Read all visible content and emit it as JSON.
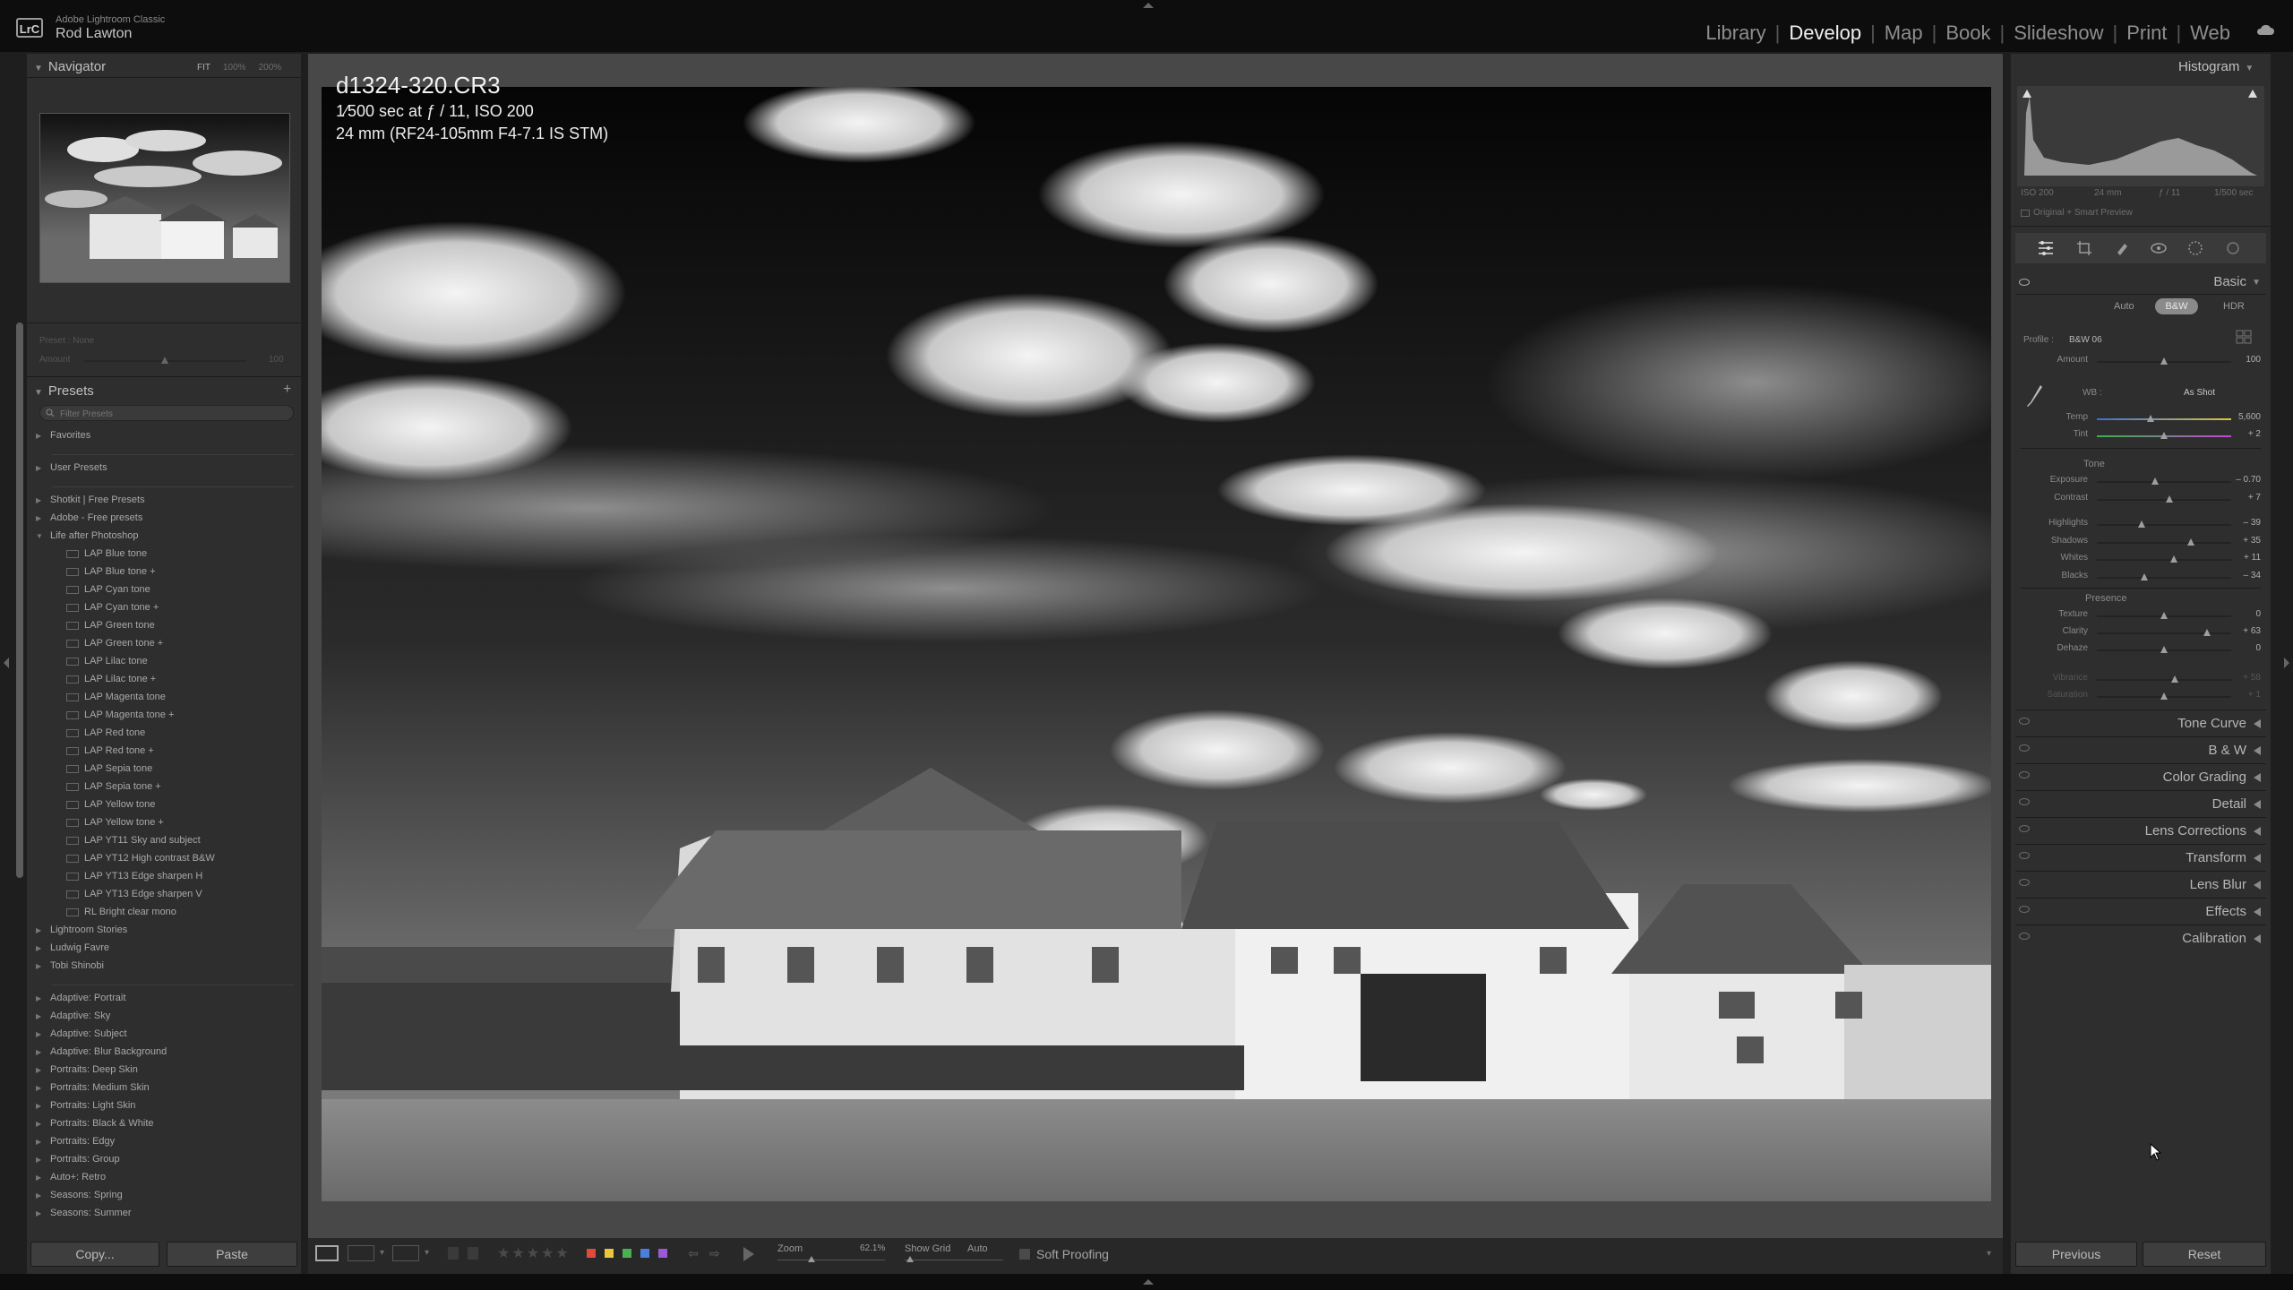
{
  "app": {
    "name": "Adobe Lightroom Classic",
    "logo": "LrC",
    "user": "Rod Lawton"
  },
  "modules": [
    {
      "label": "Library",
      "active": false
    },
    {
      "label": "Develop",
      "active": true
    },
    {
      "label": "Map",
      "active": false
    },
    {
      "label": "Book",
      "active": false
    },
    {
      "label": "Slideshow",
      "active": false
    },
    {
      "label": "Print",
      "active": false
    },
    {
      "label": "Web",
      "active": false
    }
  ],
  "navigator": {
    "title": "Navigator",
    "zoom_options": [
      "FIT",
      "100%",
      "200%"
    ],
    "preset_label": "Preset : None",
    "amount_label": "Amount",
    "amount_value": "100"
  },
  "presets": {
    "title": "Presets",
    "search_placeholder": "Filter Presets",
    "items": [
      {
        "label": "Favorites",
        "type": "group"
      },
      {
        "label": "User Presets",
        "type": "group"
      },
      {
        "label": "Shotkit | Free Presets",
        "type": "group"
      },
      {
        "label": "Adobe - Free presets",
        "type": "group"
      },
      {
        "label": "Life after Photoshop",
        "type": "open-group"
      },
      {
        "label": "LAP Blue tone",
        "type": "child"
      },
      {
        "label": "LAP Blue tone +",
        "type": "child"
      },
      {
        "label": "LAP Cyan tone",
        "type": "child"
      },
      {
        "label": "LAP Cyan tone +",
        "type": "child"
      },
      {
        "label": "LAP Green tone",
        "type": "child"
      },
      {
        "label": "LAP Green tone +",
        "type": "child"
      },
      {
        "label": "LAP Lilac tone",
        "type": "child"
      },
      {
        "label": "LAP Lilac tone +",
        "type": "child"
      },
      {
        "label": "LAP Magenta tone",
        "type": "child"
      },
      {
        "label": "LAP Magenta tone +",
        "type": "child"
      },
      {
        "label": "LAP Red tone",
        "type": "child"
      },
      {
        "label": "LAP Red tone +",
        "type": "child"
      },
      {
        "label": "LAP Sepia tone",
        "type": "child"
      },
      {
        "label": "LAP Sepia tone +",
        "type": "child"
      },
      {
        "label": "LAP Yellow tone",
        "type": "child"
      },
      {
        "label": "LAP Yellow tone +",
        "type": "child"
      },
      {
        "label": "LAP YT11 Sky and subject",
        "type": "child"
      },
      {
        "label": "LAP YT12 High contrast B&W",
        "type": "child"
      },
      {
        "label": "LAP YT13 Edge sharpen H",
        "type": "child"
      },
      {
        "label": "LAP YT13 Edge sharpen V",
        "type": "child"
      },
      {
        "label": "RL Bright clear mono",
        "type": "child"
      },
      {
        "label": "Lightroom Stories",
        "type": "group"
      },
      {
        "label": "Ludwig Favre",
        "type": "group"
      },
      {
        "label": "Tobi Shinobi",
        "type": "group"
      },
      {
        "label": "Adaptive: Portrait",
        "type": "group"
      },
      {
        "label": "Adaptive: Sky",
        "type": "group"
      },
      {
        "label": "Adaptive: Subject",
        "type": "group"
      },
      {
        "label": "Adaptive: Blur Background",
        "type": "group"
      },
      {
        "label": "Portraits: Deep Skin",
        "type": "group"
      },
      {
        "label": "Portraits: Medium Skin",
        "type": "group"
      },
      {
        "label": "Portraits: Light Skin",
        "type": "group"
      },
      {
        "label": "Portraits: Black & White",
        "type": "group"
      },
      {
        "label": "Portraits: Edgy",
        "type": "group"
      },
      {
        "label": "Portraits: Group",
        "type": "group"
      },
      {
        "label": "Auto+: Retro",
        "type": "group"
      },
      {
        "label": "Seasons: Spring",
        "type": "group"
      },
      {
        "label": "Seasons: Summer",
        "type": "group"
      }
    ]
  },
  "left_buttons": {
    "copy": "Copy...",
    "paste": "Paste"
  },
  "image_info": {
    "filename": "d1324-320.CR3",
    "exposure_line": "1⁄500 sec at ƒ / 11, ISO 200",
    "lens_line": "24 mm (RF24-105mm F4-7.1 IS STM)"
  },
  "histogram": {
    "title": "Histogram",
    "iso": "ISO 200",
    "focal": "24 mm",
    "aperture": "ƒ / 11",
    "shutter": "1/500 sec",
    "preview": "Original + Smart Preview"
  },
  "basic": {
    "title": "Basic",
    "treatments": [
      {
        "label": "Auto",
        "active": false
      },
      {
        "label": "B&W",
        "active": true
      },
      {
        "label": "HDR",
        "active": false
      }
    ],
    "profile_label": "Profile :",
    "profile_value": "B&W 06",
    "amount": {
      "label": "Amount",
      "value": "100",
      "pos": 0.5
    },
    "wb_label": "WB :",
    "wb_value": "As Shot",
    "temp": {
      "label": "Temp",
      "value": "5,600",
      "pos": 0.4
    },
    "tint": {
      "label": "Tint",
      "value": "+ 2",
      "pos": 0.5
    },
    "tone_label": "Tone",
    "tone": [
      {
        "label": "Exposure",
        "value": "– 0.70",
        "pos": 0.43
      },
      {
        "label": "Contrast",
        "value": "+ 7",
        "pos": 0.54
      },
      {
        "label": "Highlights",
        "value": "– 39",
        "pos": 0.33
      },
      {
        "label": "Shadows",
        "value": "+ 35",
        "pos": 0.7
      },
      {
        "label": "Whites",
        "value": "+ 11",
        "pos": 0.57
      },
      {
        "label": "Blacks",
        "value": "– 34",
        "pos": 0.35
      }
    ],
    "presence_label": "Presence",
    "presence": [
      {
        "label": "Texture",
        "value": "0",
        "pos": 0.5,
        "dim": false
      },
      {
        "label": "Clarity",
        "value": "+ 63",
        "pos": 0.82,
        "dim": false
      },
      {
        "label": "Dehaze",
        "value": "0",
        "pos": 0.5,
        "dim": false
      },
      {
        "label": "Vibrance",
        "value": "+ 58",
        "pos": 0.58,
        "dim": true
      },
      {
        "label": "Saturation",
        "value": "+ 1",
        "pos": 0.5,
        "dim": true
      }
    ]
  },
  "sections": [
    "Tone Curve",
    "B & W",
    "Color Grading",
    "Detail",
    "Lens Corrections",
    "Transform",
    "Lens Blur",
    "Effects",
    "Calibration"
  ],
  "right_buttons": {
    "previous": "Previous",
    "reset": "Reset"
  },
  "toolbar": {
    "zoom_label": "Zoom",
    "zoom_value": "62.1%",
    "grid_label": "Show Grid",
    "grid_value": "Auto",
    "soft_proofing": "Soft Proofing"
  },
  "colors": {
    "red": "#e04a3a",
    "yellow": "#e8c83a",
    "green": "#4caf50",
    "blue": "#4a7fe0",
    "purple": "#9a5ad8"
  }
}
